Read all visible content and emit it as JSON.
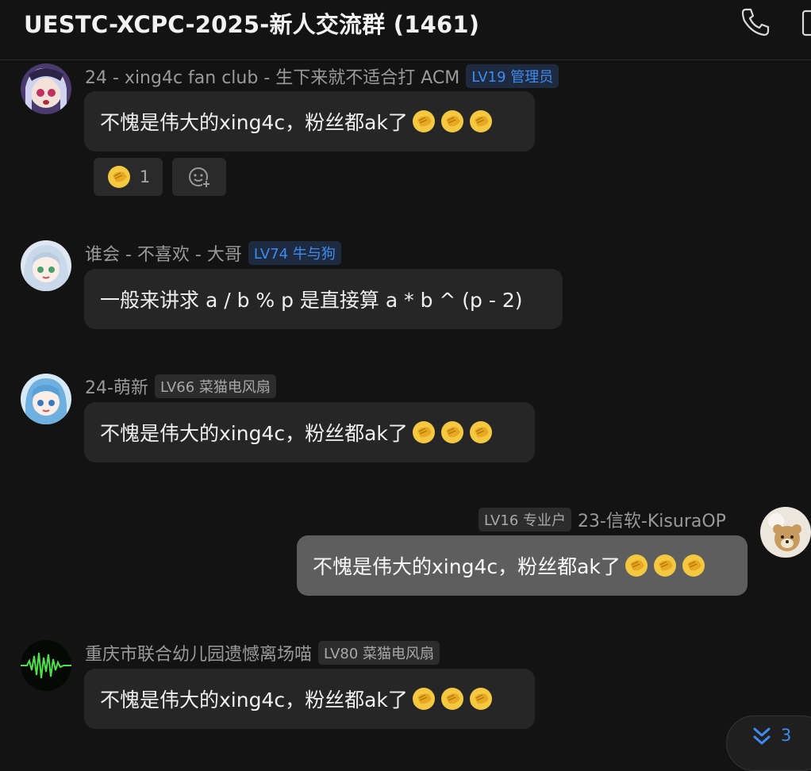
{
  "header": {
    "title": "UESTC-XCPC-2025-新人交流群 (1461)",
    "icons": [
      "phone-icon",
      "more-icon"
    ]
  },
  "messages": [
    {
      "name": "24 - xing4c fan club - 生下来就不适合打 ACM",
      "badge": "LV19 管理员",
      "text": "不愧是伟大的xing4c，粉丝都ak了",
      "emoji": "clap-emoji",
      "reactions": {
        "count": "1"
      }
    },
    {
      "name": "谁会 - 不喜欢 - 大哥",
      "badge": "LV74 牛与狗",
      "text": "一般来讲求 a / b % p 是直接算 a * b ^ (p - 2)"
    },
    {
      "name": "24-萌新",
      "badge": "LV66 菜猫电风扇",
      "text": "不愧是伟大的xing4c，粉丝都ak了",
      "emoji": "clap-emoji"
    },
    {
      "name": "23-信软-KisuraOP",
      "badge": "LV16 专业户",
      "text": "不愧是伟大的xing4c，粉丝都ak了",
      "emoji": "clap-emoji",
      "mine": true
    },
    {
      "name": "重庆市联合幼儿园遗憾离场喵",
      "badge": "LV80 菜猫电风扇",
      "text": "不愧是伟大的xing4c，粉丝都ak了",
      "emoji": "clap-emoji"
    }
  ],
  "scroll_button": {
    "count": "3"
  },
  "colors": {
    "background": "#131313",
    "bubble": "#262626",
    "own_bubble": "#5e5e5e",
    "accent": "#3f8cf0"
  }
}
